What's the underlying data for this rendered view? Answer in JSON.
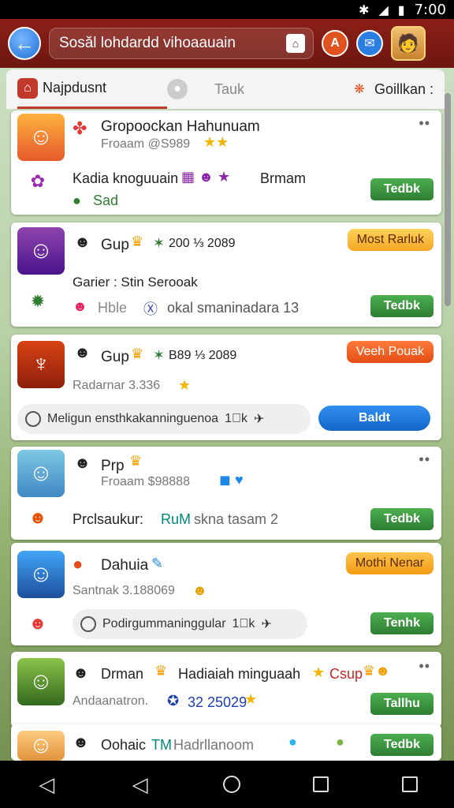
{
  "status": {
    "bt": "✱",
    "time": "7:00"
  },
  "appbar": {
    "title": "Sosăl lohdardd vihoaauain",
    "profile_emoji": "🧑"
  },
  "tabs": [
    {
      "label": "Najpdusnt",
      "icon": "house-icon"
    },
    {
      "label": "",
      "icon": "chat-icon"
    },
    {
      "label": "Tauk",
      "icon": ""
    },
    {
      "label": "Goillkan :",
      "icon": "flame-icon"
    }
  ],
  "cards": [
    {
      "title": "Gropoockan Hahunuam",
      "sub": "Froaam @S989",
      "line2": "Kadia knoguuain",
      "line2_tail": "Brmam",
      "line3": "Sad",
      "button": "Tedbk"
    },
    {
      "title": "Gup",
      "score": "200 ⅓ 2089",
      "badge": "Most Rarluk",
      "line2": "Garier : Stin Serooak",
      "line3": "Hble",
      "line3_tail": "okal smaninadara 13",
      "button": "Tedbk"
    },
    {
      "title": "Gup",
      "score": "B89 ⅓ 2089",
      "badge": "Veeh Pouak",
      "line2": "Radarnar 3.336",
      "note": "Meligun ensthkakanninguenoa",
      "note_tail": "1⃝k",
      "toggle": "Baldt"
    },
    {
      "title": "Prp",
      "sub": "Froaam $98888",
      "line2": "Prclsaukur:",
      "line2_mid": "RuM",
      "line2_tail": "skna tasam  2",
      "button": "Tedbk"
    },
    {
      "title": "Dahuia",
      "badge": "Mothi Nenar",
      "line2": "Santnak 3.188069",
      "note": "Podirgummaninggular",
      "note_tail": "1⃝k",
      "button": "Tenhk"
    },
    {
      "title": "Drman",
      "title_mid": "Hadiaiah minguaah",
      "title_tail": "Csup",
      "line2": "Andaanatron.",
      "line2_tail": "32 25029",
      "button": "Tallhu"
    },
    {
      "title": "Oohaic",
      "title_mid": "TM",
      "title_tail": "Hadrllanoom",
      "button": "Tedbk"
    }
  ],
  "colors": {
    "appbar": "#7a1a12",
    "green_btn": "#2e7d32",
    "badge_yellow": "#f5b026",
    "badge_orange": "#f0621c",
    "toggle_blue": "#1f7ae0"
  }
}
